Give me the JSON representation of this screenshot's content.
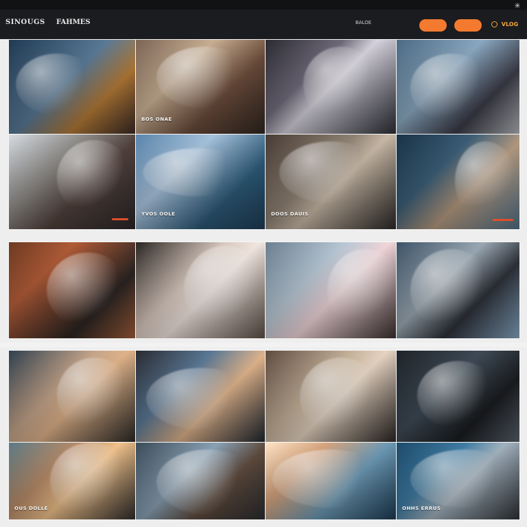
{
  "header": {
    "utility_left": "",
    "utility_right": [
      {
        "label": ""
      },
      {
        "label": ""
      },
      {
        "label": ""
      },
      {
        "label": ""
      }
    ],
    "brand_left": "SINOUGS",
    "brand_right": "FAHMES",
    "nav_left": [
      {
        "label": ""
      },
      {
        "label": ""
      },
      {
        "label": ""
      },
      {
        "label": ""
      }
    ],
    "nav_right": [
      {
        "label": ""
      },
      {
        "label": ""
      },
      {
        "label": "BALOE"
      }
    ],
    "buttons": [
      {
        "label": ""
      },
      {
        "label": ""
      }
    ],
    "vlog": "VLOG"
  },
  "captions": {
    "row1": [
      "",
      "BOS ONAE",
      "",
      ""
    ],
    "row2": [
      "",
      "YVOS OOLE",
      "DOOS DAUIS",
      ""
    ],
    "row3": [
      "",
      "",
      "",
      ""
    ],
    "row4": [
      "",
      "",
      "",
      ""
    ],
    "row5": [
      "OUS DOLLE",
      "",
      "",
      "OHHS ERRUS"
    ]
  }
}
